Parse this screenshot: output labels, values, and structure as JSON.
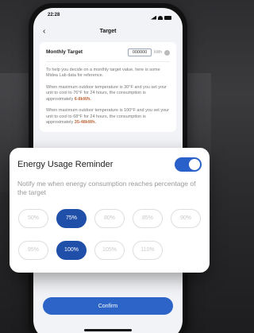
{
  "status_bar": {
    "time": "22:28"
  },
  "nav": {
    "back_icon": "‹",
    "title": "Target"
  },
  "target": {
    "label": "Monthly Target",
    "value": "000000",
    "unit": "kWh"
  },
  "info": {
    "intro": "To help you decide on a monthly target value, here is some Midea Lab data for reference.",
    "para1_text": "When maximum outdoor temperature is 30°F and you set your unit to cool to 76°F for 24 hours, the consumption is approximately",
    "para1_value": "6-8kWh.",
    "para2_text": "When maximum outdoor temperature is 100°F and you set your unit to cool to 68°F for 24 hours, the consumption is approximately",
    "para2_value": "35-48kWh."
  },
  "confirm_label": "Confirm",
  "reminder": {
    "title": "Energy Usage Reminder",
    "toggle_on": true,
    "description": "Notify me when energy consumption reaches percentage of the target",
    "options_row1": [
      "50%",
      "75%",
      "80%",
      "85%",
      "90%"
    ],
    "options_row2": [
      "95%",
      "100%",
      "105%",
      "110%"
    ],
    "selected": [
      "75%",
      "100%"
    ]
  },
  "colors": {
    "accent": "#2a60c9",
    "chip_selected": "#1f4fa8",
    "highlight": "#c06a3c"
  }
}
